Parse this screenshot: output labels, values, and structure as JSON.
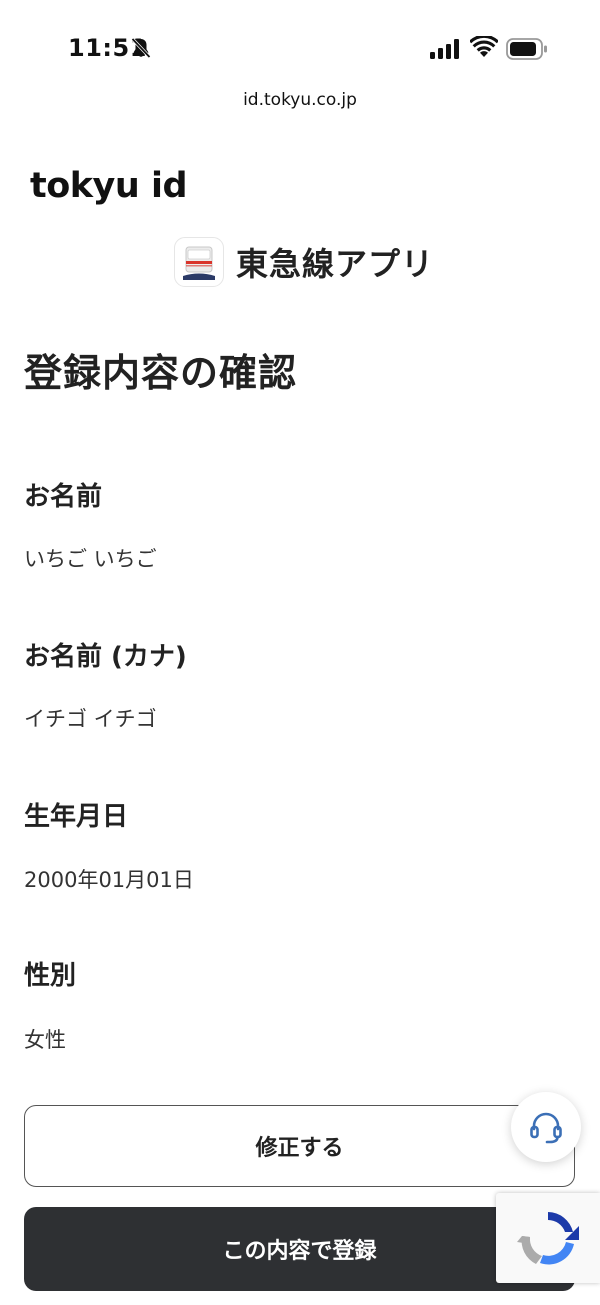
{
  "status_bar": {
    "time": "11:51"
  },
  "browser": {
    "url": "id.tokyu.co.jp"
  },
  "brand": {
    "logo_text": "tokyu id"
  },
  "app": {
    "name": "東急線アプリ"
  },
  "page": {
    "title": "登録内容の確認"
  },
  "fields": [
    {
      "label": "お名前",
      "value": "いちご いちご"
    },
    {
      "label": "お名前 (カナ)",
      "value": "イチゴ イチゴ"
    },
    {
      "label": "生年月日",
      "value": "2000年01月01日"
    },
    {
      "label": "性別",
      "value": "女性"
    }
  ],
  "buttons": {
    "edit": "修正する",
    "register": "この内容で登録"
  },
  "colors": {
    "primary_button": "#2e3033",
    "support_icon": "#3b6fb6",
    "app_icon_stripe": "#d9342b"
  }
}
